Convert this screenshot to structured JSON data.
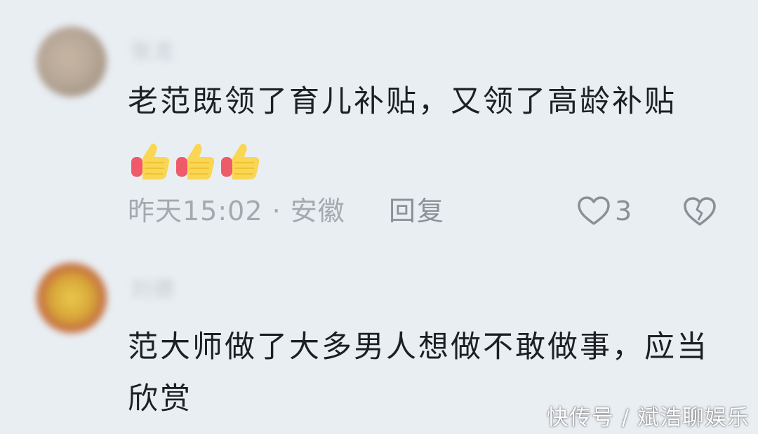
{
  "comments": [
    {
      "username": "张龙",
      "text": "老范既领了育儿补贴，又领了高龄补贴",
      "emojis": [
        "thumbs-up",
        "thumbs-up",
        "thumbs-up"
      ],
      "time_location": "昨天15:02 · 安徽",
      "reply_label": "回复",
      "like_count": "3"
    },
    {
      "username": "刘德",
      "text": "范大师做了大多男人想做不敢做事，应当欣赏"
    }
  ],
  "watermark": "快传号 / 斌浩聊娱乐",
  "colors": {
    "background": "#e9eef3",
    "text": "#1c2026",
    "meta": "#a3a9b1",
    "icon": "#8a9098"
  }
}
